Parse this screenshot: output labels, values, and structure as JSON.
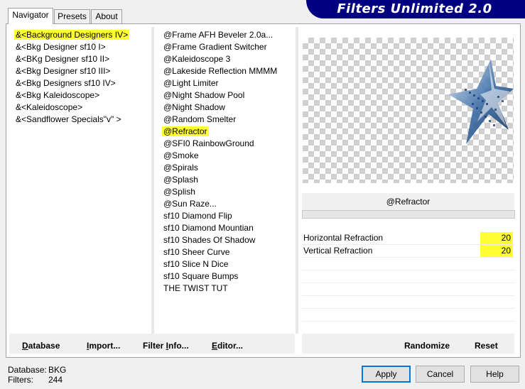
{
  "app": {
    "title": "Filters Unlimited 2.0"
  },
  "tabs": [
    {
      "label": "Navigator",
      "active": true
    },
    {
      "label": "Presets",
      "active": false
    },
    {
      "label": "About",
      "active": false
    }
  ],
  "categories": [
    {
      "label": "&<Background Designers IV>",
      "selected": true
    },
    {
      "label": "&<Bkg Designer sf10 I>",
      "selected": false
    },
    {
      "label": "&<BKg Designer sf10 II>",
      "selected": false
    },
    {
      "label": "&<Bkg Designer sf10 III>",
      "selected": false
    },
    {
      "label": "&<Bkg Designers sf10 IV>",
      "selected": false
    },
    {
      "label": "&<Bkg Kaleidoscope>",
      "selected": false
    },
    {
      "label": "&<Kaleidoscope>",
      "selected": false
    },
    {
      "label": "&<Sandflower Specials\"v\" >",
      "selected": false
    }
  ],
  "filters": [
    {
      "label": "@Frame AFH Beveler 2.0a...",
      "selected": false
    },
    {
      "label": "@Frame Gradient Switcher",
      "selected": false
    },
    {
      "label": "@Kaleidoscope 3",
      "selected": false
    },
    {
      "label": "@Lakeside Reflection MMMM",
      "selected": false
    },
    {
      "label": "@Light Limiter",
      "selected": false
    },
    {
      "label": "@Night Shadow Pool",
      "selected": false
    },
    {
      "label": "@Night Shadow",
      "selected": false
    },
    {
      "label": "@Random Smelter",
      "selected": false
    },
    {
      "label": "@Refractor",
      "selected": true
    },
    {
      "label": "@SFI0 RainbowGround",
      "selected": false
    },
    {
      "label": "@Smoke",
      "selected": false
    },
    {
      "label": "@Spirals",
      "selected": false
    },
    {
      "label": "@Splash",
      "selected": false
    },
    {
      "label": "@Splish",
      "selected": false
    },
    {
      "label": "@Sun Raze...",
      "selected": false
    },
    {
      "label": "sf10 Diamond Flip",
      "selected": false
    },
    {
      "label": "sf10 Diamond Mountian",
      "selected": false
    },
    {
      "label": "sf10 Shades Of Shadow",
      "selected": false
    },
    {
      "label": "sf10 Sheer Curve",
      "selected": false
    },
    {
      "label": "sf10 Slice N Dice",
      "selected": false
    },
    {
      "label": "sf10 Square Bumps",
      "selected": false
    },
    {
      "label": "THE TWIST TUT",
      "selected": false
    }
  ],
  "current_filter": "@Refractor",
  "params": [
    {
      "label": "Horizontal Refraction",
      "value": "20"
    },
    {
      "label": "Vertical Refraction",
      "value": "20"
    }
  ],
  "bottom_buttons": {
    "database": {
      "label": "Database",
      "underline": "D",
      "rest": "atabase"
    },
    "import": {
      "label": "Import...",
      "underline": "I",
      "rest": "mport..."
    },
    "filter_info": {
      "label": "Filter Info...",
      "pre": "Filter ",
      "underline": "I",
      "rest": "nfo..."
    },
    "editor": {
      "label": "Editor...",
      "underline": "E",
      "rest": "ditor..."
    },
    "randomize": {
      "label": "Randomize"
    },
    "reset": {
      "label": "Reset"
    }
  },
  "status": {
    "database_label": "Database:",
    "database_value": "BKG",
    "filters_label": "Filters:",
    "filters_value": "244"
  },
  "dialog_buttons": {
    "apply": "Apply",
    "cancel": "Cancel",
    "help": "Help"
  },
  "colors": {
    "banner": "#000080",
    "highlight": "#ffff33"
  }
}
